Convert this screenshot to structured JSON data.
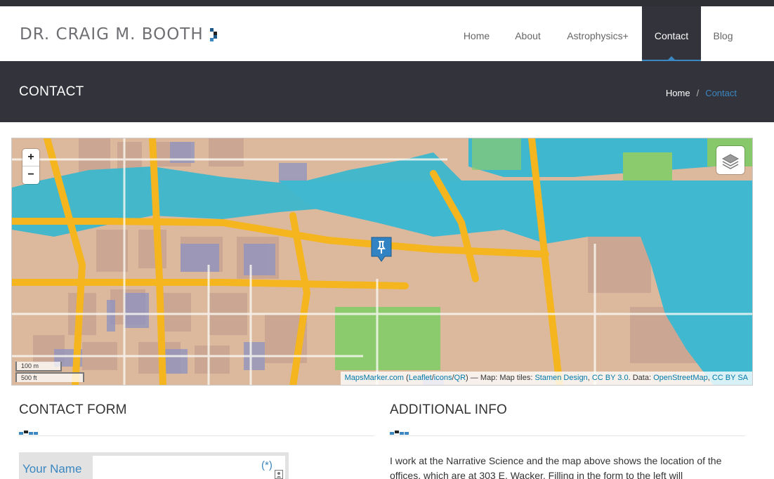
{
  "site": {
    "logo_text": "DR. CRAIG M. BOOTH",
    "logo_mark_colors": [
      "#1d5a8a",
      "#222222",
      "#1d5a8a",
      "#3a87c1"
    ]
  },
  "nav": {
    "items": [
      {
        "label": "Home"
      },
      {
        "label": "About"
      },
      {
        "label": "Astrophysics+"
      },
      {
        "label": "Contact",
        "active": true
      },
      {
        "label": "Blog"
      }
    ]
  },
  "title_bar": {
    "title": "CONTACT",
    "breadcrumb": {
      "home": "Home",
      "separator": "/",
      "current": "Contact"
    }
  },
  "map": {
    "zoom_in_label": "+",
    "zoom_out_label": "−",
    "layers_icon": "layers-icon",
    "marker_icon": "pin-marker-icon",
    "scale_metric": "100 m",
    "scale_imperial": "500 ft",
    "attribution": {
      "mapsmarker": "MapsMarker.com",
      "open_paren": " (",
      "leaflet": "Leaflet",
      "slash1": "/",
      "icons": "icons",
      "slash2": "/",
      "qr": "QR",
      "middle": ") — Map: Map tiles: ",
      "stamen": "Stamen Design",
      "comma1": ", ",
      "ccby": "CC BY 3.0",
      "data_text": ". Data: ",
      "osm": "OpenStreetMap",
      "comma2": ", ",
      "ccbysa": "CC BY SA"
    }
  },
  "contact_form": {
    "title": "CONTACT FORM",
    "name_label": "Your Name",
    "name_required": "(*)",
    "name_value": ""
  },
  "additional_info": {
    "title": "ADDITIONAL INFO",
    "text": "I work at the Narrative Science and the map above shows the location of the offices, which are at 303 E. Wacker. Filling in the form to the left will"
  },
  "colors": {
    "accent": "#3a87c1",
    "dark_bar": "#33333b",
    "water": "#3fb8cf",
    "road": "#f5b51f",
    "park": "#86c86a",
    "block": "#c9a592"
  }
}
